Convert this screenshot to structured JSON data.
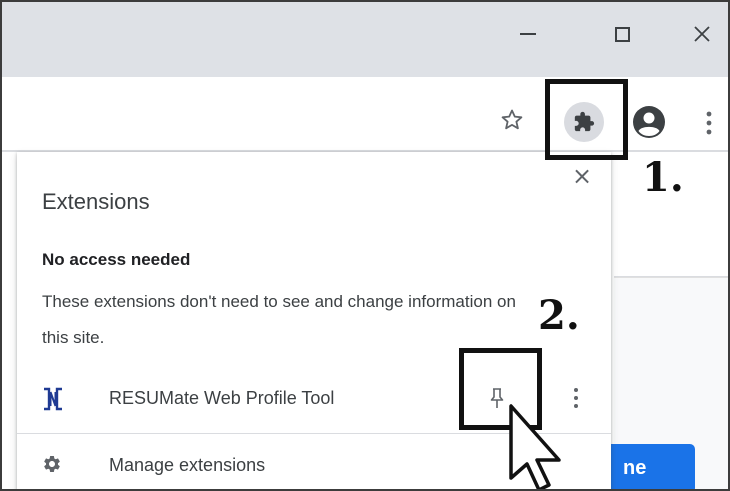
{
  "window": {
    "minimize_icon": "minimize-icon",
    "maximize_icon": "maximize-icon",
    "close_icon": "close-icon"
  },
  "toolbar": {
    "icons": [
      "star-bookmark-icon",
      "puzzle-extensions-icon",
      "profile-avatar-icon",
      "kebab-menu-icon"
    ]
  },
  "annotations": {
    "step1": "1.",
    "step2": "2."
  },
  "popup": {
    "title": "Extensions",
    "close_glyph": "×",
    "section_heading": "No access needed",
    "section_description": "These extensions don't need to see and change information on this site.",
    "extensions": [
      {
        "name": "RESUMate Web Profile Tool",
        "logo": "resumate-logo-icon",
        "pin_icon": "pin-icon",
        "menu_icon": "more-options-icon"
      }
    ],
    "manage_label": "Manage extensions"
  },
  "page": {
    "button_partial_label": "ne"
  },
  "colors": {
    "titlebar": "#dee1e6",
    "accent_blue": "#1a73e8",
    "extensions_icon_bg": "#d9dbe0"
  }
}
